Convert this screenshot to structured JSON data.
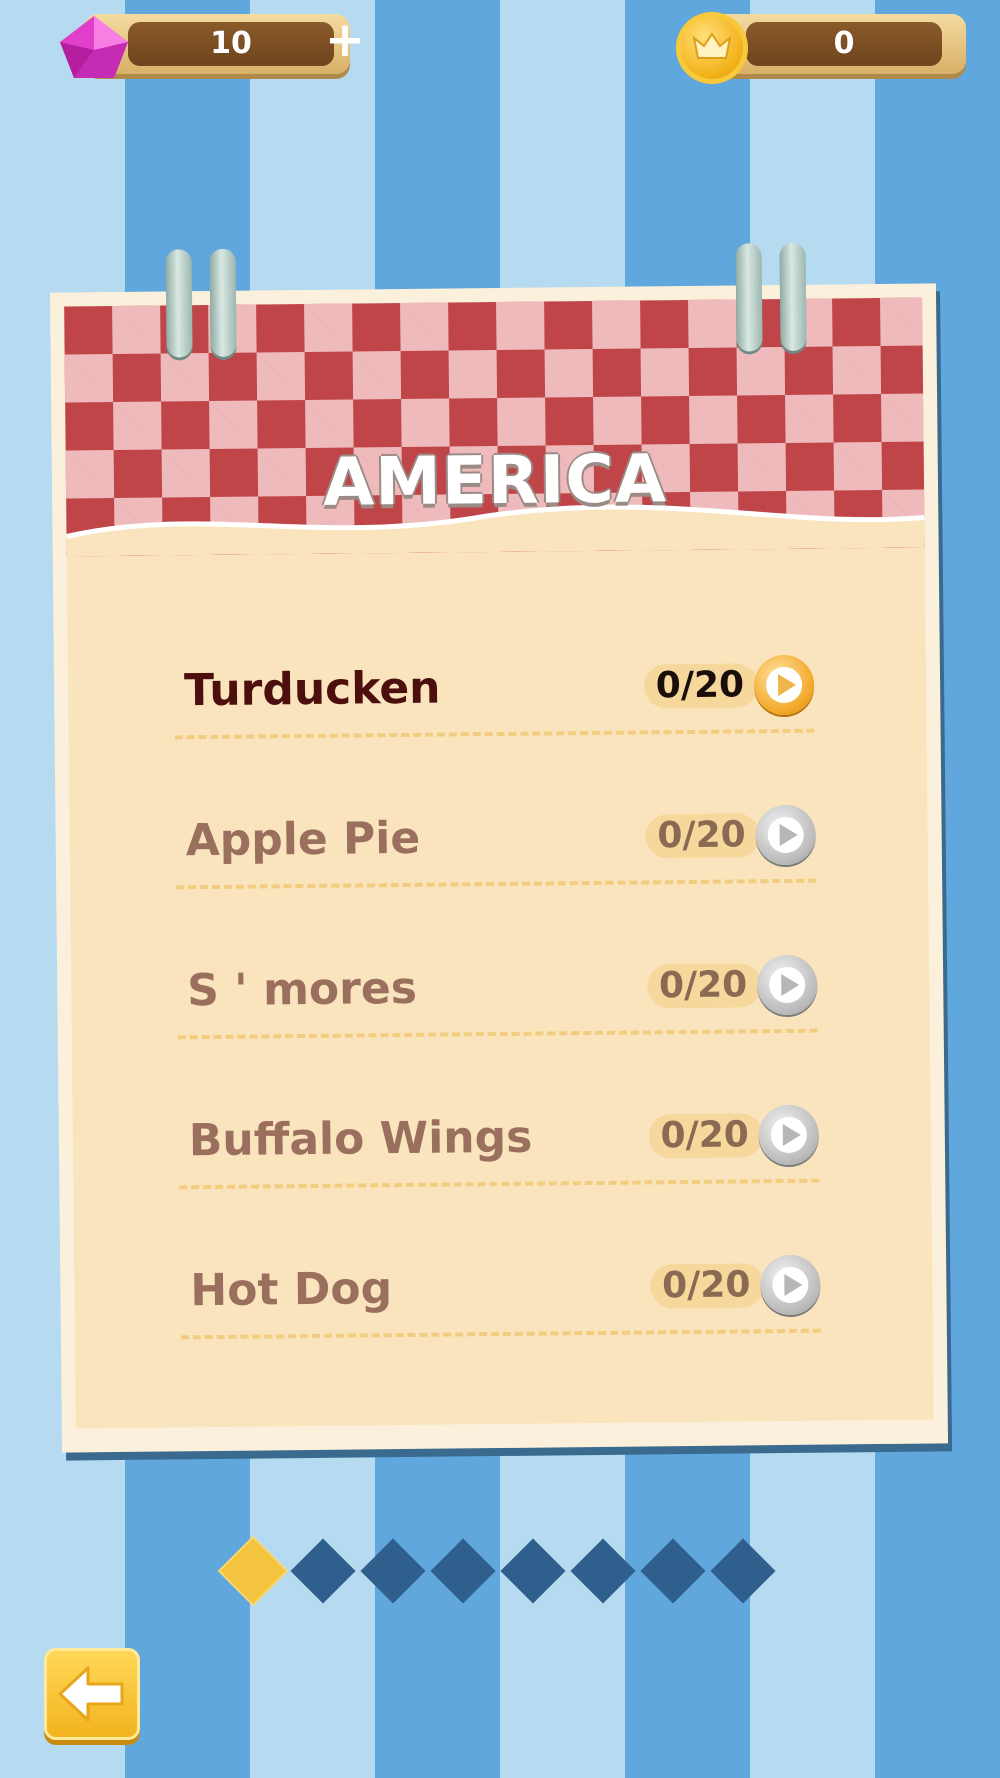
{
  "currency": {
    "gems": "10",
    "add_label": "+",
    "coins": "0"
  },
  "notebook": {
    "title": "AMERICA",
    "dishes": [
      {
        "name": "Turducken",
        "progress": "0/20",
        "unlocked": true
      },
      {
        "name": "Apple Pie",
        "progress": "0/20",
        "unlocked": false
      },
      {
        "name": "S ' mores",
        "progress": "0/20",
        "unlocked": false
      },
      {
        "name": "Buffalo Wings",
        "progress": "0/20",
        "unlocked": false
      },
      {
        "name": "Hot Dog",
        "progress": "0/20",
        "unlocked": false
      }
    ]
  },
  "pagination": {
    "total_pages": 8,
    "current_page": 1
  },
  "colors": {
    "accent_orange": "#f3a92c",
    "stripe_light": "#b6daef",
    "stripe_dark": "#5fa7dc",
    "gingham_red": "#d9656a"
  },
  "icons": {
    "gem": "gem-icon",
    "coin": "crown-coin-icon",
    "back": "arrow-left-icon",
    "play": "play-icon"
  }
}
